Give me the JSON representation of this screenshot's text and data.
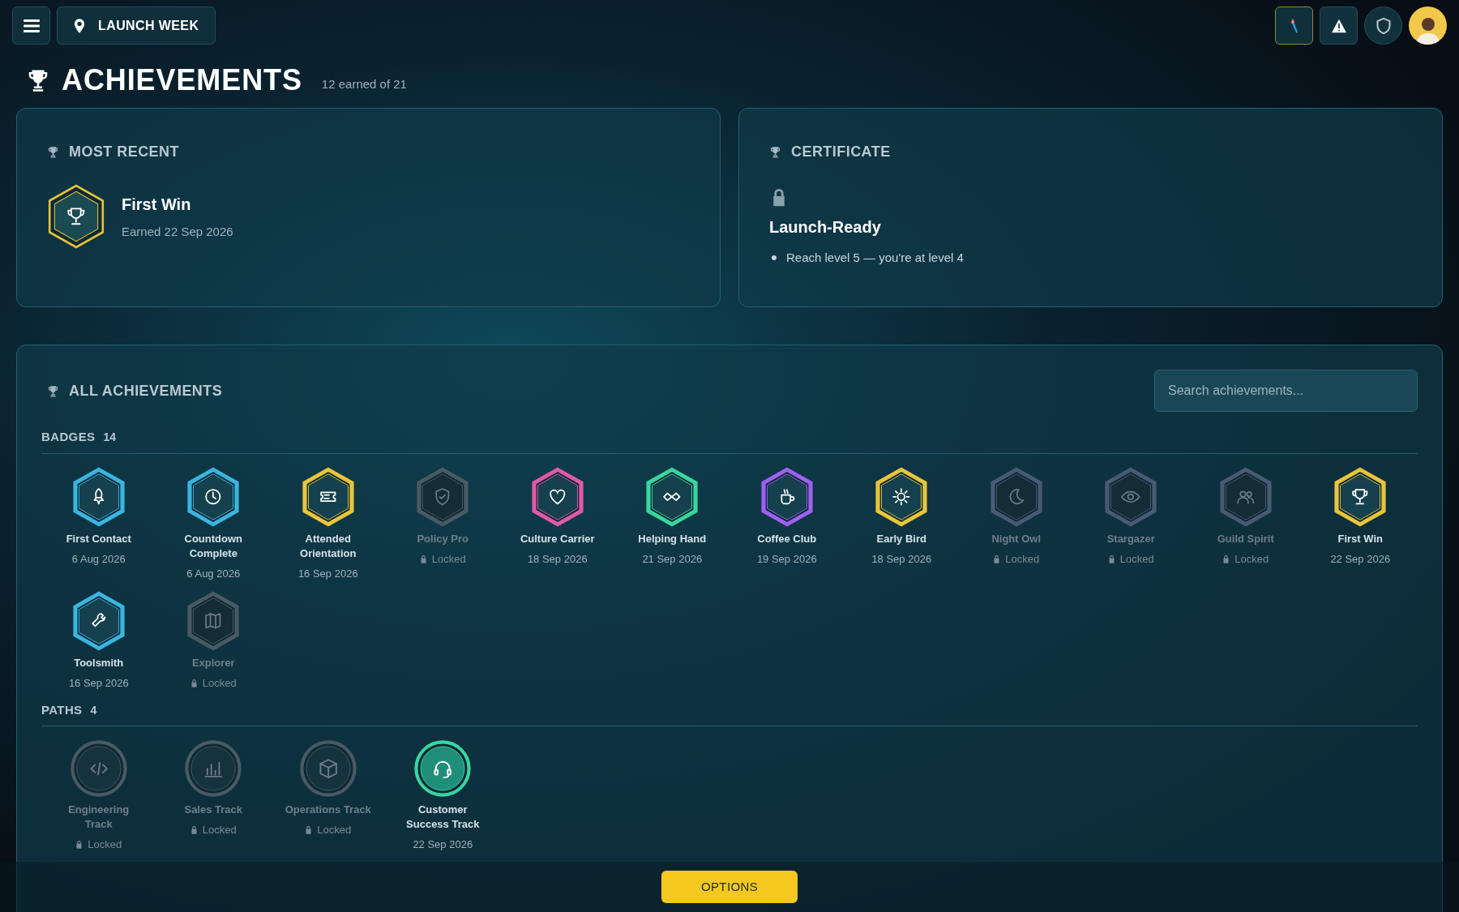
{
  "top_bar": {
    "location": "LAUNCH WEEK"
  },
  "header": {
    "title": "ACHIEVEMENTS",
    "summary": "12 earned of 21"
  },
  "most_recent": {
    "heading": "MOST RECENT",
    "name": "First Win",
    "earned": "Earned 22 Sep 2026",
    "color": "#e8c53a"
  },
  "certificate": {
    "heading": "CERTIFICATE",
    "locked": true,
    "name": "Launch-Ready",
    "requirements": [
      "Reach level 5 — you're at level 4"
    ]
  },
  "all_achievements": {
    "heading": "ALL ACHIEVEMENTS",
    "search": {
      "placeholder": "Search achievements..."
    },
    "sections": [
      {
        "title": "BADGES",
        "count": "14",
        "kind": "badge",
        "items": [
          {
            "name": "First Contact",
            "status": "6 Aug 2026",
            "locked": false,
            "color": "#3ab6e0"
          },
          {
            "name": "Countdown Complete",
            "status": "6 Aug 2026",
            "locked": false,
            "color": "#3ab6e0"
          },
          {
            "name": "Attended Orientation",
            "status": "16 Sep 2026",
            "locked": false,
            "color": "#e8c53a"
          },
          {
            "name": "Policy Pro",
            "status": "Locked",
            "locked": true,
            "color": "#4a5a64"
          },
          {
            "name": "Culture Carrier",
            "status": "18 Sep 2026",
            "locked": false,
            "color": "#e05aa8"
          },
          {
            "name": "Helping Hand",
            "status": "21 Sep 2026",
            "locked": false,
            "color": "#3ad6a0"
          },
          {
            "name": "Coffee Club",
            "status": "19 Sep 2026",
            "locked": false,
            "color": "#a060f0"
          },
          {
            "name": "Early Bird",
            "status": "18 Sep 2026",
            "locked": false,
            "color": "#e8c53a"
          },
          {
            "name": "Night Owl",
            "status": "Locked",
            "locked": true,
            "color": "#4a5a74"
          },
          {
            "name": "Stargazer",
            "status": "Locked",
            "locked": true,
            "color": "#4a5a74"
          },
          {
            "name": "Guild Spirit",
            "status": "Locked",
            "locked": true,
            "color": "#4a5a74"
          },
          {
            "name": "First Win",
            "status": "22 Sep 2026",
            "locked": false,
            "color": "#e8c53a"
          },
          {
            "name": "Toolsmith",
            "status": "16 Sep 2026",
            "locked": false,
            "color": "#3ab6e0"
          },
          {
            "name": "Explorer",
            "status": "Locked",
            "locked": true,
            "color": "#4a5a64"
          }
        ]
      },
      {
        "title": "PATHS",
        "count": "4",
        "kind": "path",
        "items": [
          {
            "name": "Engineering Track",
            "status": "Locked",
            "locked": true,
            "color": "#4a5a64"
          },
          {
            "name": "Sales Track",
            "status": "Locked",
            "locked": true,
            "color": "#4a5a64"
          },
          {
            "name": "Operations Track",
            "status": "Locked",
            "locked": true,
            "color": "#4a5a64"
          },
          {
            "name": "Customer Success Track",
            "status": "22 Sep 2026",
            "locked": false,
            "color": "#3ad6a0"
          }
        ]
      }
    ]
  },
  "footer": {
    "button": "OPTIONS"
  }
}
